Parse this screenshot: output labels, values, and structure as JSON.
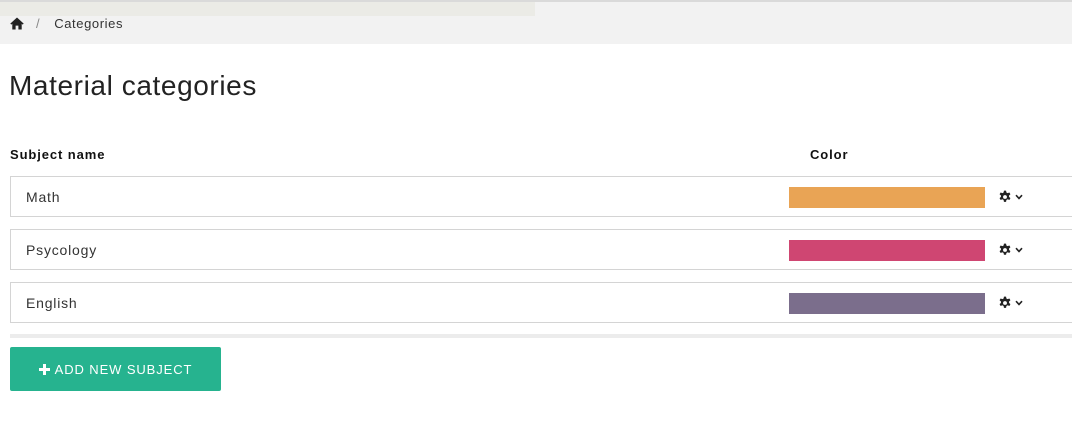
{
  "breadcrumb": {
    "home_icon": "home-icon",
    "separator": "/",
    "current": "Categories"
  },
  "page": {
    "title": "Material categories"
  },
  "table": {
    "headers": {
      "subject_name": "Subject name",
      "color": "Color"
    },
    "rows": [
      {
        "name": "Math",
        "color": "#e9a455",
        "actions_icon": "gear-icon"
      },
      {
        "name": "Psycology",
        "color": "#cf4672",
        "actions_icon": "gear-icon"
      },
      {
        "name": "English",
        "color": "#7b6e8c",
        "actions_icon": "gear-icon"
      }
    ]
  },
  "actions": {
    "add_subject_label": "ADD NEW SUBJECT",
    "add_subject_icon": "plus-icon",
    "add_subject_color": "#26b38f"
  }
}
